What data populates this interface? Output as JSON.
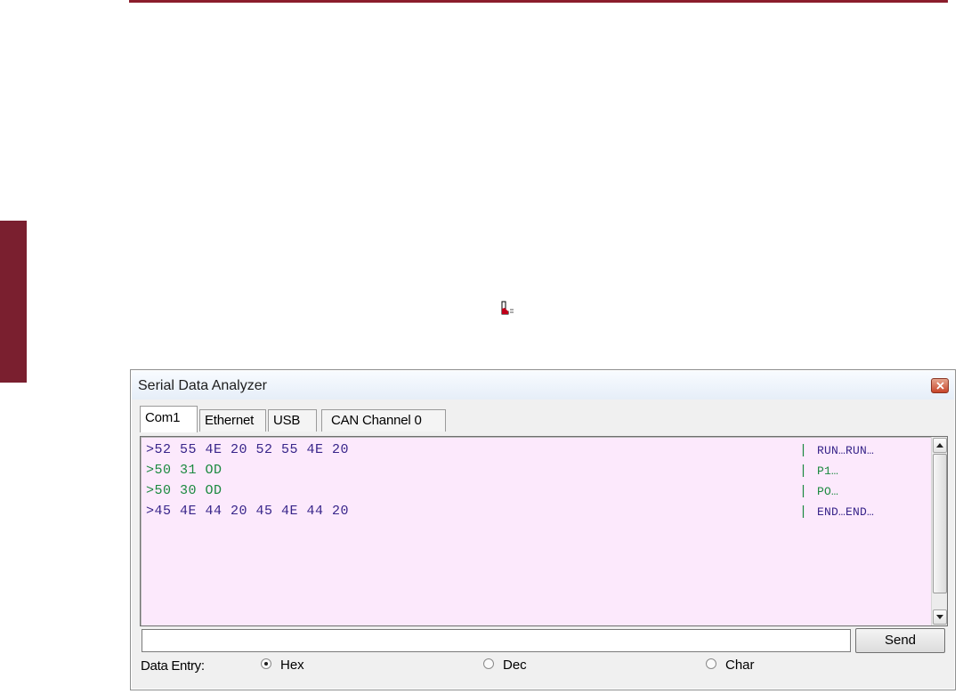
{
  "window": {
    "title": "Serial Data Analyzer",
    "close_icon": "close-icon"
  },
  "tabs": [
    {
      "label": "Com1",
      "active": true
    },
    {
      "label": "Ethernet",
      "active": false
    },
    {
      "label": "USB",
      "active": false
    },
    {
      "label": "CAN Channel 0",
      "active": false
    }
  ],
  "log": {
    "background": "#fce9fc",
    "separator": "|",
    "lines": [
      {
        "hex": ">52 55 4E 20 52 55 4E 20",
        "ascii": "RUN…RUN…",
        "color": "#38258a"
      },
      {
        "hex": ">50 31 OD",
        "ascii": "P1…",
        "color": "#1c8a40"
      },
      {
        "hex": ">50 30 OD",
        "ascii": "PO…",
        "color": "#1c8a40"
      },
      {
        "hex": ">45 4E 44 20 45 4E 44 20",
        "ascii": "END…END…",
        "color": "#38258a"
      }
    ]
  },
  "entry": {
    "value": "",
    "send_label": "Send",
    "data_entry_label": "Data Entry:",
    "options": [
      {
        "label": "Hex",
        "selected": true
      },
      {
        "label": "Dec",
        "selected": false
      },
      {
        "label": "Char",
        "selected": false
      }
    ]
  },
  "colors": {
    "accent": "#8b1d2c",
    "sidebar": "#7a1f2f"
  }
}
